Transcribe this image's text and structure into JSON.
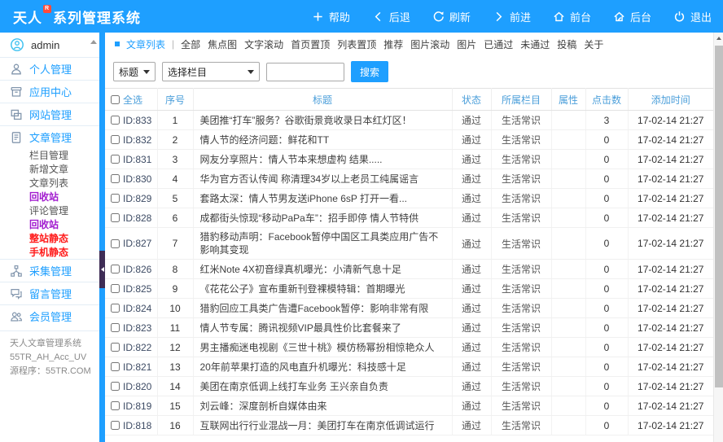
{
  "header": {
    "logo_prefix": "天人",
    "logo_badge": "R",
    "logo_suffix": "系列管理系统",
    "menu": [
      {
        "label": "帮助",
        "icon": "plus"
      },
      {
        "label": "后退",
        "icon": "chevron-left"
      },
      {
        "label": "刷新",
        "icon": "refresh"
      },
      {
        "label": "前进",
        "icon": "chevron-right"
      },
      {
        "label": "前台",
        "icon": "home"
      },
      {
        "label": "后台",
        "icon": "home-pen"
      },
      {
        "label": "退出",
        "icon": "power"
      }
    ]
  },
  "sidebar": {
    "items": [
      {
        "type": "user",
        "label": "admin",
        "icon": "user-circle"
      },
      {
        "type": "main",
        "label": "个人管理",
        "icon": "user"
      },
      {
        "type": "main",
        "label": "应用中心",
        "icon": "app"
      },
      {
        "type": "main",
        "label": "网站管理",
        "icon": "site"
      },
      {
        "type": "main",
        "label": "文章管理",
        "icon": "article"
      },
      {
        "type": "sub",
        "label": "栏目管理"
      },
      {
        "type": "sub",
        "label": "新增文章"
      },
      {
        "type": "sub",
        "label": "文章列表"
      },
      {
        "type": "sub",
        "label": "回收站",
        "color": "purple"
      },
      {
        "type": "sub",
        "label": "评论管理"
      },
      {
        "type": "sub",
        "label": "回收站",
        "color": "purple"
      },
      {
        "type": "sub",
        "label": "整站静态",
        "color": "red"
      },
      {
        "type": "sub",
        "label": "手机静态",
        "color": "red"
      },
      {
        "type": "main",
        "label": "采集管理",
        "icon": "collect"
      },
      {
        "type": "main",
        "label": "留言管理",
        "icon": "message"
      },
      {
        "type": "main",
        "label": "会员管理",
        "icon": "members"
      }
    ],
    "footer": [
      "天人文章管理系统",
      "55TR_AH_Acc_UV",
      "源程序：55TR.COM"
    ]
  },
  "content": {
    "nav": {
      "title": "文章列表",
      "separator": "|",
      "tabs": [
        "全部",
        "焦点图",
        "文字滚动",
        "首页置顶",
        "列表置顶",
        "推荐",
        "图片滚动",
        "图片",
        "已通过",
        "未通过",
        "投稿",
        "关于"
      ]
    },
    "filter": {
      "field_select": "标题",
      "column_select": "选择栏目",
      "search_value": "",
      "search_button": "搜索"
    },
    "table": {
      "columns": [
        "全选",
        "序号",
        "标题",
        "状态",
        "所属栏目",
        "属性",
        "点击数",
        "添加时间"
      ],
      "rows": [
        {
          "id": "ID:833",
          "no": 1,
          "title": "美团推“打车”服务？谷歌街景竟收录日本红灯区！",
          "status": "通过",
          "column": "生活常识",
          "attr": "",
          "clicks": 3,
          "time": "17-02-14 21:27"
        },
        {
          "id": "ID:832",
          "no": 2,
          "title": "情人节的经济问题：鲜花和TT",
          "status": "通过",
          "column": "生活常识",
          "attr": "",
          "clicks": 0,
          "time": "17-02-14 21:27"
        },
        {
          "id": "ID:831",
          "no": 3,
          "title": "网友分享照片：情人节本来想虚构 结果.....",
          "status": "通过",
          "column": "生活常识",
          "attr": "",
          "clicks": 0,
          "time": "17-02-14 21:27"
        },
        {
          "id": "ID:830",
          "no": 4,
          "title": "华为官方否认传闻 称清理34岁以上老员工纯属谣言",
          "status": "通过",
          "column": "生活常识",
          "attr": "",
          "clicks": 0,
          "time": "17-02-14 21:27"
        },
        {
          "id": "ID:829",
          "no": 5,
          "title": "套路太深：情人节男友送iPhone 6sP 打开一看...",
          "status": "通过",
          "column": "生活常识",
          "attr": "",
          "clicks": 0,
          "time": "17-02-14 21:27"
        },
        {
          "id": "ID:828",
          "no": 6,
          "title": "成都街头惊现“移动PaPa车”：招手即停 情人节特供",
          "status": "通过",
          "column": "生活常识",
          "attr": "",
          "clicks": 0,
          "time": "17-02-14 21:27"
        },
        {
          "id": "ID:827",
          "no": 7,
          "title": "猎豹移动声明：Facebook暂停中国区工具类应用广告不影响其变现",
          "status": "通过",
          "column": "生活常识",
          "attr": "",
          "clicks": 0,
          "time": "17-02-14 21:27"
        },
        {
          "id": "ID:826",
          "no": 8,
          "title": "红米Note 4X初音绿真机曝光：小清新气息十足",
          "status": "通过",
          "column": "生活常识",
          "attr": "",
          "clicks": 0,
          "time": "17-02-14 21:27"
        },
        {
          "id": "ID:825",
          "no": 9,
          "title": "《花花公子》宣布重新刊登裸模特辑：首期曝光",
          "status": "通过",
          "column": "生活常识",
          "attr": "",
          "clicks": 0,
          "time": "17-02-14 21:27"
        },
        {
          "id": "ID:824",
          "no": 10,
          "title": "猎豹回应工具类广告遭Facebook暂停：影响非常有限",
          "status": "通过",
          "column": "生活常识",
          "attr": "",
          "clicks": 0,
          "time": "17-02-14 21:27"
        },
        {
          "id": "ID:823",
          "no": 11,
          "title": "情人节专属：腾讯视频VIP最具性价比套餐来了",
          "status": "通过",
          "column": "生活常识",
          "attr": "",
          "clicks": 0,
          "time": "17-02-14 21:27"
        },
        {
          "id": "ID:822",
          "no": 12,
          "title": "男主播痴迷电视剧《三世十桃》模仿杨幂扮相惊艳众人",
          "status": "通过",
          "column": "生活常识",
          "attr": "",
          "clicks": 0,
          "time": "17-02-14 21:27"
        },
        {
          "id": "ID:821",
          "no": 13,
          "title": "20年前苹果打造的风电直升机曝光：科技感十足",
          "status": "通过",
          "column": "生活常识",
          "attr": "",
          "clicks": 0,
          "time": "17-02-14 21:27"
        },
        {
          "id": "ID:820",
          "no": 14,
          "title": "美团在南京低调上线打车业务 王兴亲自负责",
          "status": "通过",
          "column": "生活常识",
          "attr": "",
          "clicks": 0,
          "time": "17-02-14 21:27"
        },
        {
          "id": "ID:819",
          "no": 15,
          "title": "刘云峰：深度剖析自媒体由来",
          "status": "通过",
          "column": "生活常识",
          "attr": "",
          "clicks": 0,
          "time": "17-02-14 21:27"
        },
        {
          "id": "ID:818",
          "no": 16,
          "title": "互联网出行行业混战一月：美团打车在南京低调试运行",
          "status": "通过",
          "column": "生活常识",
          "attr": "",
          "clicks": 0,
          "time": "17-02-14 21:27"
        }
      ]
    }
  },
  "colors": {
    "primary_blue": "#1E9FFF",
    "table_header_blue": "#4A9EDA",
    "sidebar_sub_purple": "#A21CCF",
    "sidebar_sub_red": "#FF1A1A",
    "logo_badge_red": "#FF4A3A"
  }
}
